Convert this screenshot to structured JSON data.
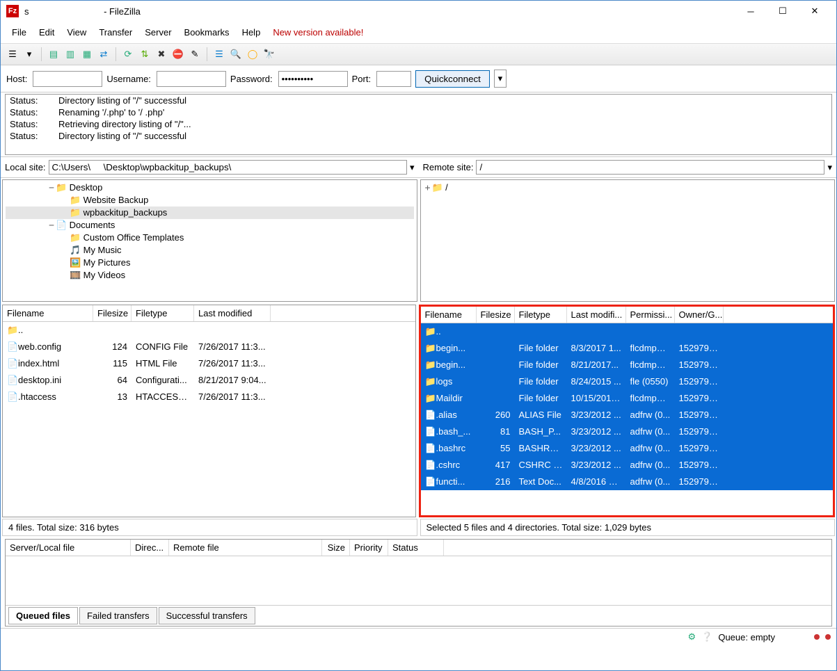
{
  "title": {
    "suffix": " - FileZilla"
  },
  "menu": {
    "file": "File",
    "edit": "Edit",
    "view": "View",
    "transfer": "Transfer",
    "server": "Server",
    "bookmarks": "Bookmarks",
    "help": "Help",
    "newver": "New version available!"
  },
  "quick": {
    "host_lbl": "Host:",
    "user_lbl": "Username:",
    "pass_lbl": "Password:",
    "port_lbl": "Port:",
    "pass_val": "••••••••••",
    "btn": "Quickconnect"
  },
  "log": [
    {
      "label": "Status:",
      "msg": "Directory listing of \"/\" successful"
    },
    {
      "label": "Status:",
      "msg": "Renaming '/.php' to '/                              .php'"
    },
    {
      "label": "Status:",
      "msg": "Retrieving directory listing of \"/\"..."
    },
    {
      "label": "Status:",
      "msg": "Directory listing of \"/\" successful"
    }
  ],
  "local_site": {
    "label": "Local site:",
    "path": "C:\\Users\\     \\Desktop\\wpbackitup_backups\\"
  },
  "remote_site": {
    "label": "Remote site:",
    "path": "/"
  },
  "local_tree": [
    {
      "indent": 3,
      "exp": "−",
      "ico": "📁",
      "label": "Desktop",
      "sel": false
    },
    {
      "indent": 4,
      "exp": "",
      "ico": "📁",
      "label": "Website Backup",
      "sel": false
    },
    {
      "indent": 4,
      "exp": "",
      "ico": "📁",
      "label": "wpbackitup_backups",
      "sel": true
    },
    {
      "indent": 3,
      "exp": "−",
      "ico": "📄",
      "label": "Documents",
      "sel": false
    },
    {
      "indent": 4,
      "exp": "",
      "ico": "📁",
      "label": "Custom Office Templates",
      "sel": false
    },
    {
      "indent": 4,
      "exp": "",
      "ico": "🎵",
      "label": "My Music",
      "sel": false
    },
    {
      "indent": 4,
      "exp": "",
      "ico": "🖼️",
      "label": "My Pictures",
      "sel": false
    },
    {
      "indent": 4,
      "exp": "",
      "ico": "🎞️",
      "label": "My Videos",
      "sel": false
    }
  ],
  "remote_tree": [
    {
      "indent": 0,
      "exp": "+",
      "ico": "📁",
      "label": "/",
      "sel": false
    }
  ],
  "local_cols": {
    "name": "Filename",
    "size": "Filesize",
    "type": "Filetype",
    "mod": "Last modified"
  },
  "remote_cols": {
    "name": "Filename",
    "size": "Filesize",
    "type": "Filetype",
    "mod": "Last modifi...",
    "perm": "Permissi...",
    "own": "Owner/G..."
  },
  "local_files": [
    {
      "ico": "📁",
      "name": "..",
      "size": "",
      "type": "",
      "mod": ""
    },
    {
      "ico": "📄",
      "name": "web.config",
      "size": "124",
      "type": "CONFIG File",
      "mod": "7/26/2017 11:3..."
    },
    {
      "ico": "📄",
      "name": "index.html",
      "size": "115",
      "type": "HTML File",
      "mod": "7/26/2017 11:3..."
    },
    {
      "ico": "📄",
      "name": "desktop.ini",
      "size": "64",
      "type": "Configurati...",
      "mod": "8/21/2017 9:04..."
    },
    {
      "ico": "📄",
      "name": ".htaccess",
      "size": "13",
      "type": "HTACCESS ...",
      "mod": "7/26/2017 11:3..."
    }
  ],
  "remote_files": [
    {
      "sel": true,
      "ico": "📁",
      "name": "..",
      "size": "",
      "type": "",
      "mod": "",
      "perm": "",
      "own": ""
    },
    {
      "sel": true,
      "ico": "📁",
      "name": "begin...",
      "size": "",
      "type": "File folder",
      "mod": "8/3/2017 1...",
      "perm": "flcdmpe ...",
      "own": "1529796..."
    },
    {
      "sel": true,
      "ico": "📁",
      "name": "begin...",
      "size": "",
      "type": "File folder",
      "mod": "8/21/2017...",
      "perm": "flcdmpe ...",
      "own": "1529796..."
    },
    {
      "sel": true,
      "ico": "📁",
      "name": "logs",
      "size": "",
      "type": "File folder",
      "mod": "8/24/2015 ...",
      "perm": "fle (0550)",
      "own": "1529796..."
    },
    {
      "sel": true,
      "ico": "📁",
      "name": "Maildir",
      "size": "",
      "type": "File folder",
      "mod": "10/15/2012...",
      "perm": "flcdmpe ...",
      "own": "1529796..."
    },
    {
      "sel": true,
      "ico": "📄",
      "name": ".alias",
      "size": "260",
      "type": "ALIAS File",
      "mod": "3/23/2012 ...",
      "perm": "adfrw (0...",
      "own": "1529796..."
    },
    {
      "sel": true,
      "ico": "📄",
      "name": ".bash_...",
      "size": "81",
      "type": "BASH_P...",
      "mod": "3/23/2012 ...",
      "perm": "adfrw (0...",
      "own": "1529796..."
    },
    {
      "sel": true,
      "ico": "📄",
      "name": ".bashrc",
      "size": "55",
      "type": "BASHRC...",
      "mod": "3/23/2012 ...",
      "perm": "adfrw (0...",
      "own": "1529796..."
    },
    {
      "sel": true,
      "ico": "📄",
      "name": ".cshrc",
      "size": "417",
      "type": "CSHRC F...",
      "mod": "3/23/2012 ...",
      "perm": "adfrw (0...",
      "own": "1529796..."
    },
    {
      "sel": true,
      "ico": "📄",
      "name": "functi...",
      "size": "216",
      "type": "Text Doc...",
      "mod": "4/8/2016 3:...",
      "perm": "adfrw (0...",
      "own": "1529796..."
    }
  ],
  "local_status": "4 files. Total size: 316 bytes",
  "remote_status": "Selected 5 files and 4 directories. Total size: 1,029 bytes",
  "queue_cols": {
    "srv": "Server/Local file",
    "dir": "Direc...",
    "rem": "Remote file",
    "size": "Size",
    "pri": "Priority",
    "stat": "Status"
  },
  "tabs": {
    "queued": "Queued files",
    "failed": "Failed transfers",
    "success": "Successful transfers"
  },
  "bottom": {
    "queue_label": "Queue: empty"
  },
  "colors": {
    "selection": "#0a6bd4",
    "highlight_border": "#e21"
  }
}
